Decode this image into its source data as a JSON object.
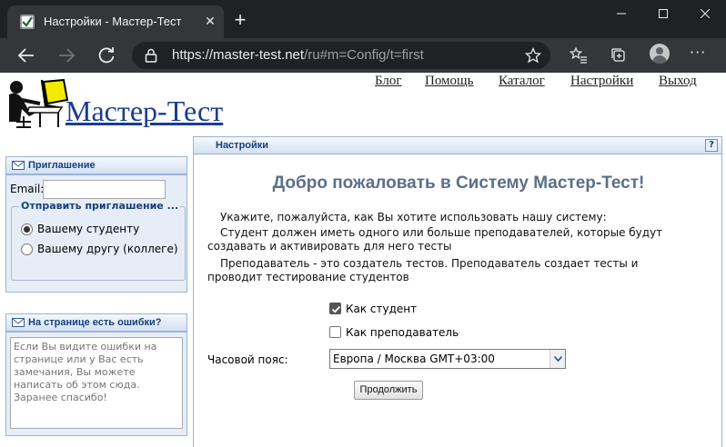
{
  "browser": {
    "tab_title": "Настройки - Мастер-Тест",
    "tab_close": "✕",
    "new_tab": "+",
    "url_host": "https://master-test.net",
    "url_path": "/ru#m=Config/t=first",
    "colors": {
      "frame": "#202124",
      "toolbar": "#35363a"
    }
  },
  "site": {
    "logo_text": "Мастер-Тест",
    "nav": [
      "Блог",
      "Помощь",
      "Каталог",
      "Настройки",
      "Выход"
    ]
  },
  "invite": {
    "title": "Приглашение",
    "email_label": "Email:",
    "email_value": "",
    "group_legend": "Отправить приглашение ...",
    "options": [
      "Вашему студенту",
      "Вашему другу (коллеге)"
    ],
    "selected": "Вашему студенту"
  },
  "feedback": {
    "title": "На странице есть ошибки?",
    "placeholder": "Если Вы видите ошибки на странице или у Вас есть замечания, Вы можете написать об этом сюда.\nЗаранее спасибо!"
  },
  "main": {
    "panel_title": "Настройки",
    "help": "?",
    "heading": "Добро пожаловать в Систему Мастер-Тест!",
    "paragraphs": [
      "Укажите, пожалуйста, как Вы хотите использовать нашу систему:",
      "Студент должен иметь одного или больше преподавателей, которые будут создавать и активировать для него тесты",
      "Преподаватель - это создатель тестов. Преподаватель создает тесты и проводит тестирование студентов"
    ],
    "roles": [
      {
        "label": "Как студент",
        "checked": true
      },
      {
        "label": "Как преподаватель",
        "checked": false
      }
    ],
    "timezone_label": "Часовой пояс:",
    "timezone_value": "Европа / Москва GMT+03:00",
    "continue_label": "Продолжить"
  }
}
